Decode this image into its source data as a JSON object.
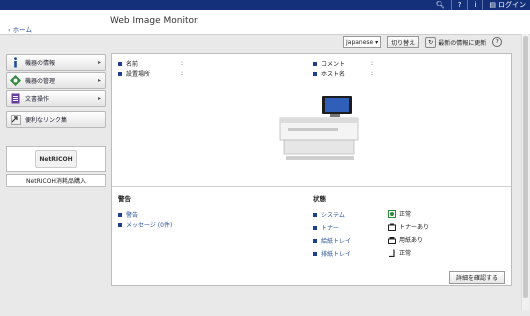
{
  "topbar": {
    "icons": [
      "search-icon",
      "help-icon",
      "info-icon",
      "list-icon"
    ],
    "login_label": "ログイン"
  },
  "header": {
    "title": "Web Image Monitor"
  },
  "breadcrumb": {
    "home": "‹ ホーム"
  },
  "sidebar": {
    "items": [
      {
        "label": "機器の情報",
        "icon": "info-icon"
      },
      {
        "label": "機器の管理",
        "icon": "gear-icon"
      },
      {
        "label": "文書操作",
        "icon": "document-icon"
      }
    ],
    "links_label": "便利なリンク集",
    "netricoh_logo": "NetRICOH",
    "purchase_label": "NetRICOH消耗品購入"
  },
  "toolbar": {
    "language": "Japanese",
    "switch_label": "切り替え",
    "refresh_label": "最新の情報に更新"
  },
  "device": {
    "name_label": "名前",
    "name_value": ":",
    "location_label": "設置場所",
    "location_value": ":",
    "comment_label": "コメント",
    "comment_value": ":",
    "host_label": "ホスト名",
    "host_value": ":"
  },
  "alerts": {
    "title": "警告",
    "items": [
      "警告",
      "メッセージ (0件)"
    ]
  },
  "status": {
    "title": "状態",
    "rows": [
      {
        "label": "システム",
        "value": "正常",
        "icon": "ok-icon"
      },
      {
        "label": "トナー",
        "value": "トナーあり",
        "icon": "toner-icon"
      },
      {
        "label": "給紙トレイ",
        "value": "用紙あり",
        "icon": "paper-icon"
      },
      {
        "label": "排紙トレイ",
        "value": "正常",
        "icon": "output-icon"
      }
    ]
  },
  "details_button": "詳細を確認する",
  "colors": {
    "topbar": "#14307a",
    "link": "#2a52a0",
    "bullet": "#1f3e8c"
  }
}
